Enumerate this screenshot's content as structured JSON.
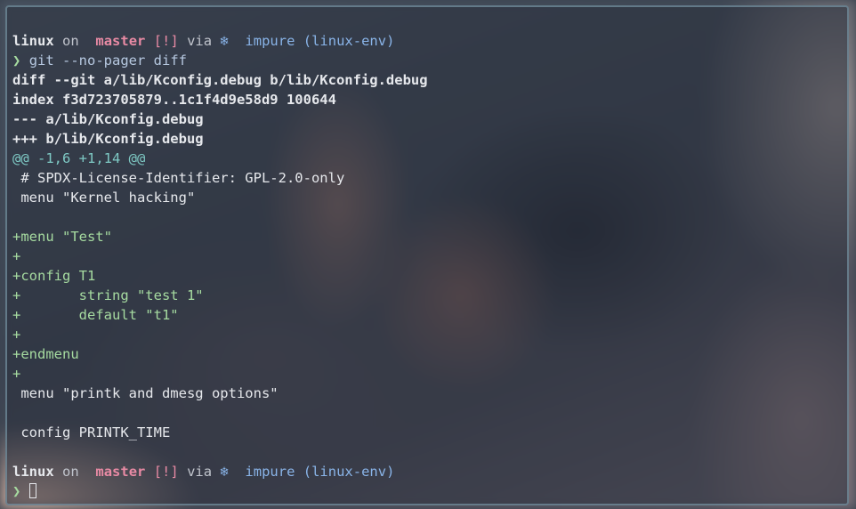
{
  "prompt": {
    "dir": "linux",
    "on": "on",
    "branch_icon": "",
    "branch": "master",
    "status": "[!]",
    "via": "via",
    "nix_icon": "❄",
    "env_state": "impure",
    "env_name": "(linux-env)",
    "symbol": "❯"
  },
  "command": "git --no-pager diff",
  "diff": {
    "header": "diff --git a/lib/Kconfig.debug b/lib/Kconfig.debug",
    "index": "index f3d723705879..1c1f4d9e58d9 100644",
    "old_file": "--- a/lib/Kconfig.debug",
    "new_file": "+++ b/lib/Kconfig.debug",
    "hunk": "@@ -1,6 +1,14 @@",
    "lines": [
      {
        "type": "ctx",
        "text": " # SPDX-License-Identifier: GPL-2.0-only"
      },
      {
        "type": "ctx",
        "text": " menu \"Kernel hacking\""
      },
      {
        "type": "ctx",
        "text": ""
      },
      {
        "type": "add",
        "text": "+menu \"Test\""
      },
      {
        "type": "add",
        "text": "+"
      },
      {
        "type": "add",
        "text": "+config T1"
      },
      {
        "type": "add",
        "text": "+       string \"test 1\""
      },
      {
        "type": "add",
        "text": "+       default \"t1\""
      },
      {
        "type": "add",
        "text": "+"
      },
      {
        "type": "add",
        "text": "+endmenu"
      },
      {
        "type": "add",
        "text": "+"
      },
      {
        "type": "ctx",
        "text": " menu \"printk and dmesg options\""
      },
      {
        "type": "ctx",
        "text": ""
      },
      {
        "type": "ctx",
        "text": " config PRINTK_TIME"
      }
    ]
  },
  "colors": {
    "branch": "#e88aa4",
    "prompt_symbol": "#a6dba0",
    "added": "#a6dba0",
    "hunk": "#7ec9c4",
    "nix": "#89b4e8"
  }
}
